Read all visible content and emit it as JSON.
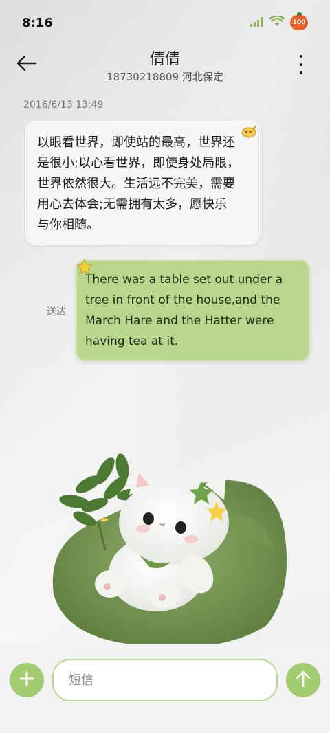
{
  "status_bar": {
    "time": "8:16",
    "battery_level": "100",
    "icons": [
      "signal-icon",
      "wifi-icon",
      "battery-icon"
    ]
  },
  "header": {
    "contact_name": "倩倩",
    "contact_detail": "18730218809 河北保定",
    "back_icon": "back-arrow-icon",
    "more_icon": "more-vertical-icon"
  },
  "conversation": {
    "timestamp": "2016/6/13 13:49",
    "incoming": {
      "lines": [
        "以眼看世界，即使站的最高，世界还",
        "是很小;以心看世界，即使身处局限，",
        "世界依然很大。生活远不完美，需要",
        "用心去体会;无需拥有太多，愿快乐",
        "与你相随。"
      ]
    },
    "outgoing": {
      "status": "送达",
      "lines": [
        "There was a table set out under a",
        "tree in front of the house,and the",
        "March Hare and the Hatter were",
        "having tea at it."
      ]
    }
  },
  "composer": {
    "placeholder": "短信",
    "value": "",
    "add_icon": "plus-icon",
    "send_icon": "send-arrow-icon"
  },
  "colors": {
    "accent_green": "#a3cb6f",
    "outgoing_bubble": "#b9d68d",
    "battery": "#e8622a"
  }
}
